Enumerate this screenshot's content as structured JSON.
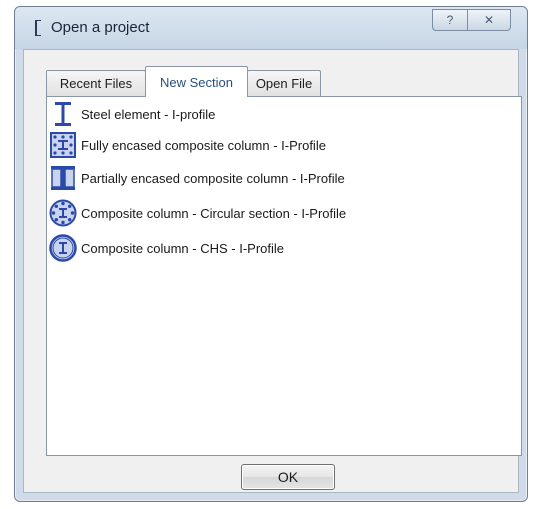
{
  "window": {
    "title": "Open a project",
    "help_glyph": "?",
    "close_glyph": "✕"
  },
  "tabs": [
    {
      "label": "Recent Files",
      "active": false
    },
    {
      "label": "New Section",
      "active": true
    },
    {
      "label": "Open File",
      "active": false
    }
  ],
  "list": {
    "items": [
      {
        "label": "Steel element - I-profile",
        "icon": "i-beam-icon"
      },
      {
        "label": "Fully encased composite column - I-Profile",
        "icon": "fully-encased-section-icon"
      },
      {
        "label": "Partially encased composite column - I-Profile",
        "icon": "partially-encased-section-icon"
      },
      {
        "label": "Composite column - Circular section - I-Profile",
        "icon": "circular-section-icon"
      },
      {
        "label": "Composite column - CHS - I-Profile",
        "icon": "chs-section-icon"
      }
    ]
  },
  "ok_button": {
    "label": "OK"
  },
  "colors": {
    "accent": "#2b4aa8",
    "window_frame": "#cfdbe8"
  }
}
